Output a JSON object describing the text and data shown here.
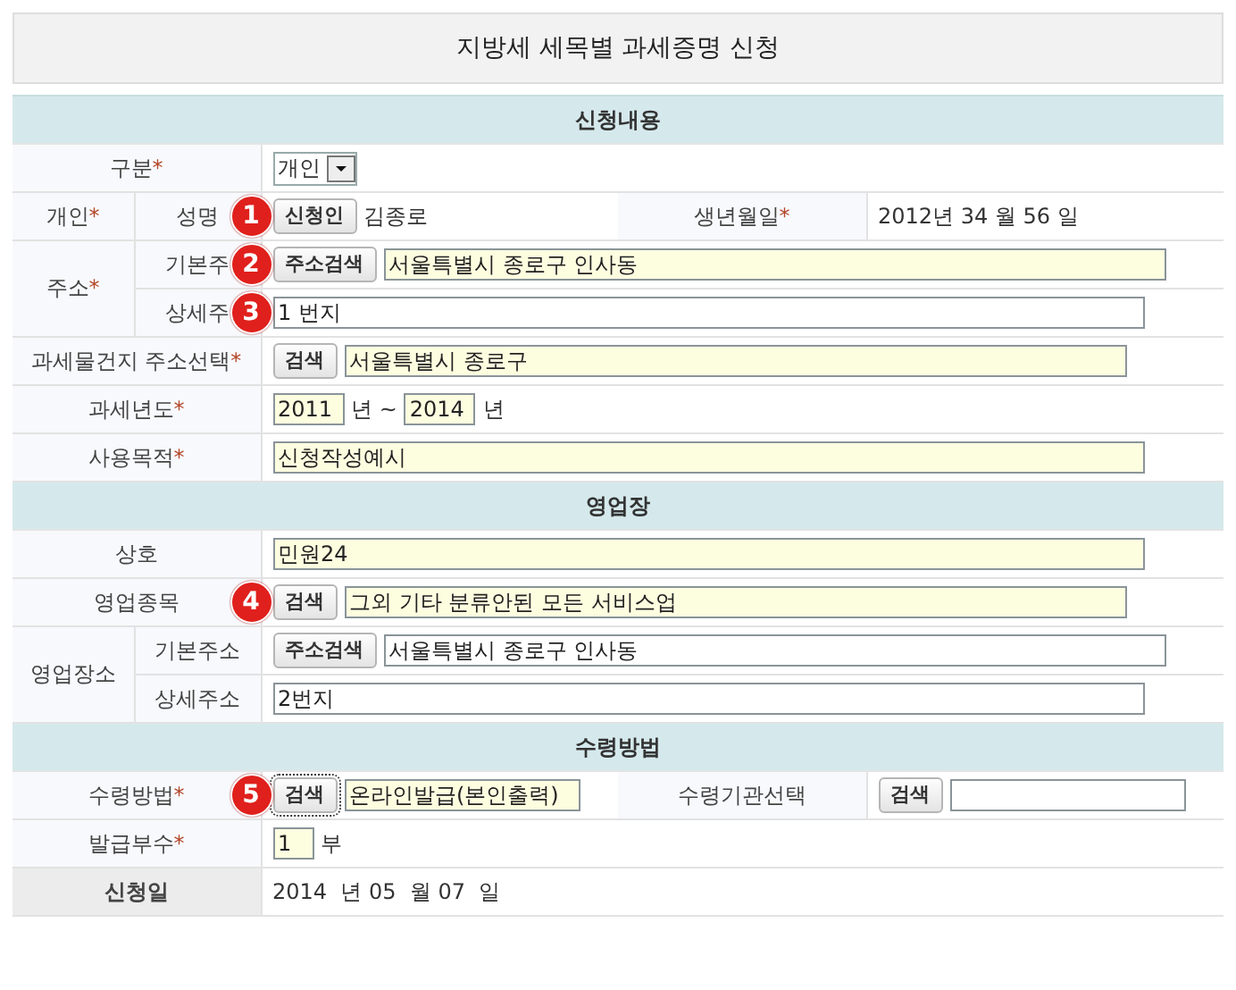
{
  "title": "지방세 세목별 과세증명 신청",
  "sections": [
    {
      "heading": "신청내용",
      "rows": [
        {
          "label": "구분",
          "star": "*",
          "controls": [
            {
              "kind": "select",
              "value": "개인"
            }
          ]
        },
        {
          "label": "개인",
          "star": "*",
          "children": [
            {
              "label": "성명",
              "badge": "1",
              "controls": [
                {
                  "kind": "button",
                  "label": "신청인"
                },
                {
                  "kind": "text",
                  "text": "김종로"
                }
              ],
              "extra": {
                "label": "생년월일",
                "star": "*",
                "controls": [
                  {
                    "kind": "text",
                    "text": "2012년 34 월 56 일"
                  }
                ]
              }
            }
          ]
        },
        {
          "label": "주소",
          "star": "*",
          "children": [
            {
              "label": "기본주",
              "badge": "2",
              "controls": [
                {
                  "kind": "button",
                  "label": "주소검색"
                },
                {
                  "kind": "longfield",
                  "value": "서울특별시 종로구 인사동",
                  "highlighted": true
                }
              ]
            },
            {
              "label": "상세주",
              "badge": "3",
              "controls": [
                {
                  "kind": "field",
                  "value": "1 번지",
                  "highlighted": false
                }
              ]
            }
          ]
        },
        {
          "label": "과세물건지 주소선택",
          "star": "*",
          "controls": [
            {
              "kind": "button",
              "label": "검색"
            },
            {
              "kind": "longfield",
              "value": "서울특별시 종로구",
              "highlighted": true
            }
          ]
        },
        {
          "label": "과세년도",
          "star": "*",
          "controls": [
            {
              "kind": "shortfield",
              "value": "2011",
              "highlighted": true
            },
            {
              "kind": "text",
              "text": "년 ~"
            },
            {
              "kind": "shortfield",
              "value": "2014",
              "highlighted": true
            },
            {
              "kind": "text",
              "text": "년"
            }
          ]
        },
        {
          "label": "사용목적",
          "star": "*",
          "controls": [
            {
              "kind": "field",
              "value": "신청작성예시",
              "highlighted": true
            }
          ]
        }
      ]
    },
    {
      "heading": "영업장",
      "rows": [
        {
          "label": "상호",
          "controls": [
            {
              "kind": "field",
              "value": "민원24",
              "highlighted": true
            }
          ]
        },
        {
          "label": "영업종목",
          "badge": "4",
          "controls": [
            {
              "kind": "button",
              "label": "검색"
            },
            {
              "kind": "longfield",
              "value": "그외 기타 분류안된 모든 서비스업",
              "highlighted": true
            }
          ]
        },
        {
          "label": "영업장소",
          "children": [
            {
              "label": "기본주소",
              "controls": [
                {
                  "kind": "button",
                  "label": "주소검색"
                },
                {
                  "kind": "longfield",
                  "value": "서울특별시 종로구 인사동",
                  "highlighted": false
                }
              ]
            },
            {
              "label": "상세주소",
              "controls": [
                {
                  "kind": "field",
                  "value": "2번지",
                  "highlighted": false
                }
              ]
            }
          ]
        }
      ]
    },
    {
      "heading": "수령방법",
      "rows": [
        {
          "label": "수령방법",
          "star": "*",
          "badge": "5",
          "controls": [
            {
              "kind": "button",
              "label": "검색",
              "focused": true
            },
            {
              "kind": "midfield",
              "value": "온라인발급(본인출력)",
              "highlighted": true
            }
          ],
          "extra": {
            "label": "수령기관선택",
            "controls": [
              {
                "kind": "button",
                "label": "검색",
                "focused": false
              },
              {
                "kind": "midfield",
                "highlighted": false
              }
            ]
          }
        },
        {
          "label": "발급부수",
          "star": "*",
          "controls": [
            {
              "kind": "tinyfield",
              "value": "1",
              "highlighted": true
            },
            {
              "kind": "text",
              "text": "부"
            }
          ]
        },
        {
          "label": "신청일",
          "emphasis": true,
          "controls": [
            {
              "kind": "text",
              "text": "2014  년 05  월 07  일"
            }
          ]
        }
      ]
    }
  ]
}
